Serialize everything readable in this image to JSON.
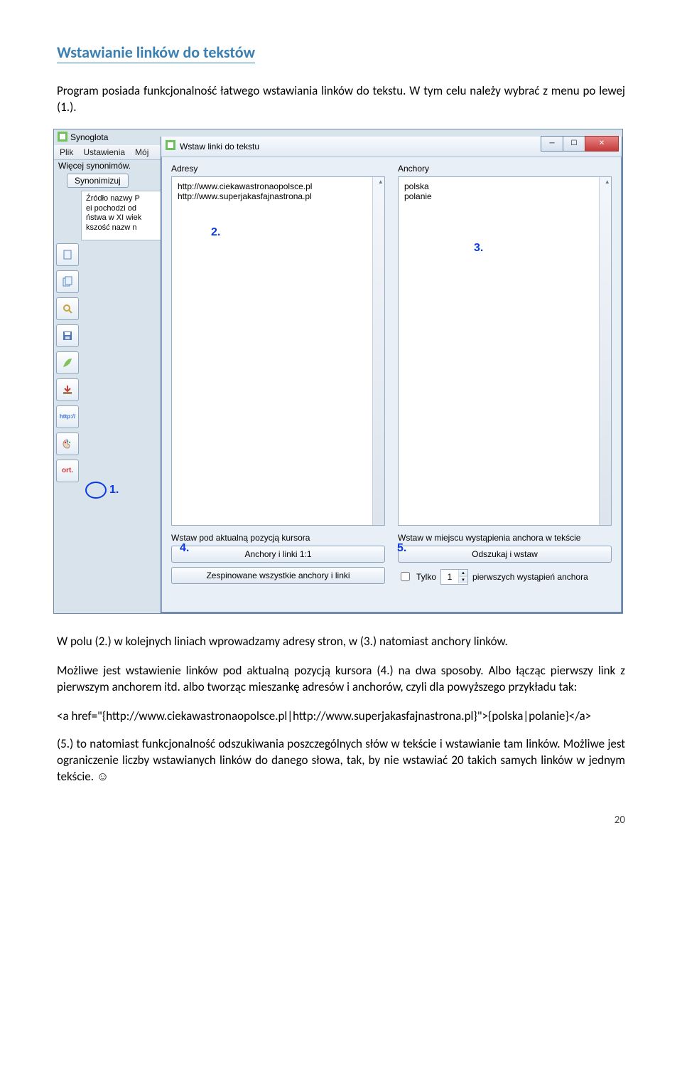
{
  "heading": "Wstawianie linków do tekstów",
  "intro": "Program posiada funkcjonalność łatwego wstawiania linków do tekstu. W tym celu należy wybrać z menu po lewej (1.).",
  "app": {
    "title_bg": "Synoglota",
    "menu": {
      "plik": "Plik",
      "ustawienia": "Ustawienia",
      "moj": "Mój"
    },
    "wiecej_syn": "Więcej synonimów.",
    "syn_button": "Synonimizuj",
    "text_preview": "Źródło nazwy P\nei pochodzi od\nństwa w XI wiek\nkszość nazw n",
    "toolbar_ort": "ort.",
    "dialog": {
      "title": "Wstaw linki do tekstu",
      "adresy_label": "Adresy",
      "anchory_label": "Anchory",
      "adresy_value": "http://www.ciekawastronaopolsce.pl\nhttp://www.superjakasfajnastrona.pl",
      "anchory_value": "polska\npolanie",
      "left_section_label": "Wstaw pod aktualną pozycją kursora",
      "right_section_label": "Wstaw w miejscu wystąpienia anchora w tekście",
      "btn_anchory_linki": "Anchory i linki 1:1",
      "btn_zespinowane": "Zespinowane wszystkie anchory i linki",
      "btn_odszukaj": "Odszukaj i wstaw",
      "chk_tylko": "Tylko",
      "spinner_value": "1",
      "chk_tylko_suffix": "pierwszych wystąpień anchora"
    }
  },
  "markers": {
    "m1": "1.",
    "m2": "2.",
    "m3": "3.",
    "m4": "4.",
    "m5": "5."
  },
  "para2": "W polu (2.) w kolejnych liniach wprowadzamy adresy stron, w (3.) natomiast anchory linków.",
  "para3": "Możliwe jest wstawienie linków pod aktualną pozycją kursora (4.) na dwa sposoby. Albo łącząc pierwszy link z pierwszym anchorem itd. albo tworząc mieszankę adresów i anchorów, czyli dla powyższego przykładu tak:",
  "code_example": "<a href=\"{http://www.ciekawastronaopolsce.pl|http://www.superjakasfajnastrona.pl}\">{polska|polanie}</a>",
  "para4": "(5.) to natomiast funkcjonalność odszukiwania poszczególnych słów w tekście i wstawianie tam linków. Możliwe jest ograniczenie liczby wstawianych linków do danego słowa, tak, by nie wstawiać 20 takich samych linków w jednym tekście. ☺",
  "pagenum": "20"
}
